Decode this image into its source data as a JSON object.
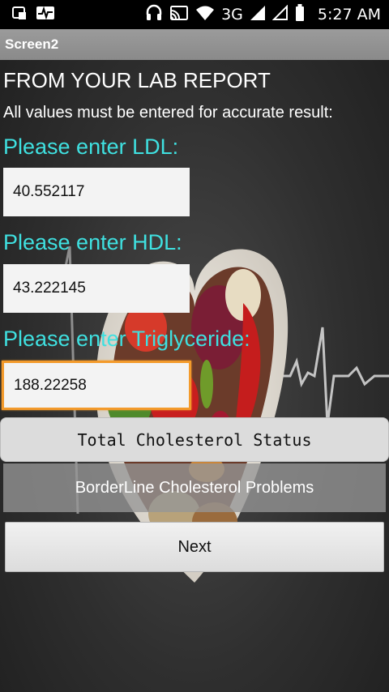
{
  "status_bar": {
    "network": "3G",
    "time": "5:27 AM",
    "icons": [
      "notification-icon",
      "activity-icon",
      "headset-icon",
      "cast-icon",
      "wifi-icon",
      "signal-icon",
      "signal-empty-icon",
      "battery-icon"
    ]
  },
  "screen_title": "Screen2",
  "heading": "FROM YOUR LAB REPORT",
  "subheading": "All values must be entered for accurate result:",
  "ldl": {
    "label": "Please enter LDL:",
    "value": "40.552117"
  },
  "hdl": {
    "label": "Please enter HDL:",
    "value": "43.222145"
  },
  "triglyceride": {
    "label": "Please enter Triglyceride:",
    "value": "188.22258"
  },
  "status_button": "Total Cholesterol Status",
  "result_text": "BorderLine Cholesterol Problems",
  "next_button": "Next",
  "colors": {
    "label_cyan": "#3fe0e0",
    "focus_orange": "#f39a2b",
    "title_bar": "#8f8f8f"
  }
}
